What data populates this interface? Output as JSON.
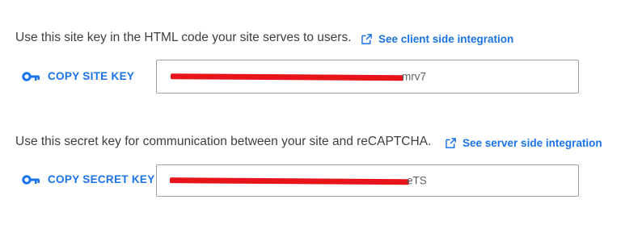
{
  "site_key_section": {
    "instruction": "Use this site key in the HTML code your site serves to users.",
    "link_label": "See client side integration",
    "copy_label": "COPY SITE KEY",
    "key_visible_suffix": "mrv7"
  },
  "secret_key_section": {
    "instruction": "Use this secret key for communication between your site and reCAPTCHA.",
    "link_label": "See server side integration",
    "copy_label": "COPY SECRET KEY",
    "key_visible_suffix": "eTS"
  },
  "icons": {
    "external_link": "open-in-new-icon",
    "key": "vpn-key-icon"
  },
  "colors": {
    "accent": "#1a73e8",
    "text": "#3c4043",
    "border": "#9aa0a6",
    "redaction": "#e8141b"
  }
}
